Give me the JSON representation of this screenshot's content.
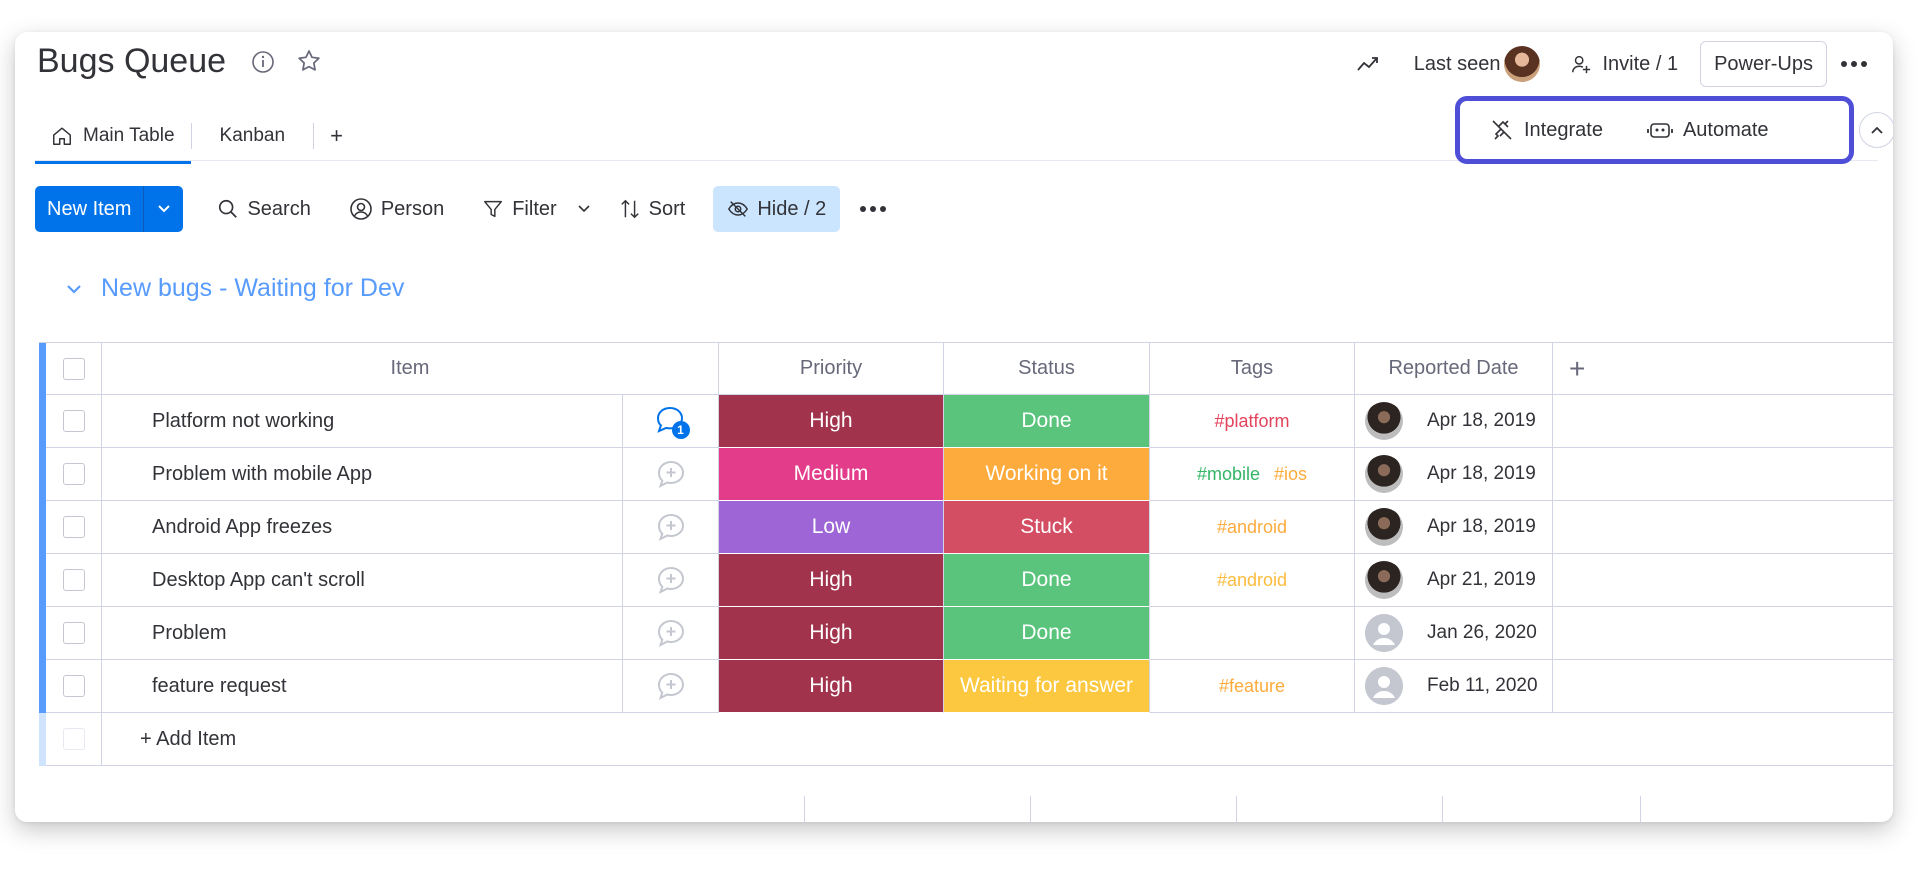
{
  "board": {
    "title": "Bugs Queue",
    "last_seen_label": "Last seen",
    "invite_label": "Invite / 1",
    "powerups_label": "Power-Ups"
  },
  "tabs": [
    {
      "label": "Main Table",
      "active": true
    },
    {
      "label": "Kanban",
      "active": false
    }
  ],
  "tab_add": "+",
  "integrations": {
    "integrate_label": "Integrate",
    "automate_label": "Automate"
  },
  "toolbar": {
    "new_item": "New Item",
    "search": "Search",
    "person": "Person",
    "filter": "Filter",
    "sort": "Sort",
    "hide": "Hide / 2"
  },
  "group": {
    "title": "New bugs - Waiting for Dev",
    "color": "#579bfc",
    "columns": [
      "Item",
      "Priority",
      "Status",
      "Tags",
      "Reported Date"
    ],
    "add_column": "+",
    "add_item": "+ Add Item",
    "rows": [
      {
        "name": "Platform not working",
        "updates": "1",
        "priority": "High",
        "priority_color": "#a1344c",
        "status": "Done",
        "status_color": "#5ac47d",
        "tags": [
          {
            "text": "#platform",
            "color": "#e2445c"
          }
        ],
        "date": "Apr 18, 2019",
        "person": "photo"
      },
      {
        "name": "Problem with mobile App",
        "updates": "",
        "priority": "Medium",
        "priority_color": "#e23c8b",
        "status": "Working on it",
        "status_color": "#fdab3d",
        "tags": [
          {
            "text": "#mobile",
            "color": "#33b567"
          },
          {
            "text": "#ios",
            "color": "#fdab3d"
          }
        ],
        "date": "Apr 18, 2019",
        "person": "photo"
      },
      {
        "name": "Android App freezes",
        "updates": "",
        "priority": "Low",
        "priority_color": "#9d65d5",
        "status": "Stuck",
        "status_color": "#d34d63",
        "tags": [
          {
            "text": "#android",
            "color": "#fdab3d"
          }
        ],
        "date": "Apr 18, 2019",
        "person": "photo"
      },
      {
        "name": "Desktop App can't scroll",
        "updates": "",
        "priority": "High",
        "priority_color": "#a1344c",
        "status": "Done",
        "status_color": "#5ac47d",
        "tags": [
          {
            "text": "#android",
            "color": "#fdbc3d"
          }
        ],
        "date": "Apr 21, 2019",
        "person": "photo"
      },
      {
        "name": "Problem",
        "updates": "",
        "priority": "High",
        "priority_color": "#a1344c",
        "status": "Done",
        "status_color": "#5ac47d",
        "tags": [],
        "date": "Jan 26, 2020",
        "person": "empty"
      },
      {
        "name": "feature request",
        "updates": "",
        "priority": "High",
        "priority_color": "#a1344c",
        "status": "Waiting for answer",
        "status_color": "#fcc83f",
        "tags": [
          {
            "text": "#feature",
            "color": "#fdab3d"
          }
        ],
        "date": "Feb 11, 2020",
        "person": "empty"
      }
    ]
  }
}
